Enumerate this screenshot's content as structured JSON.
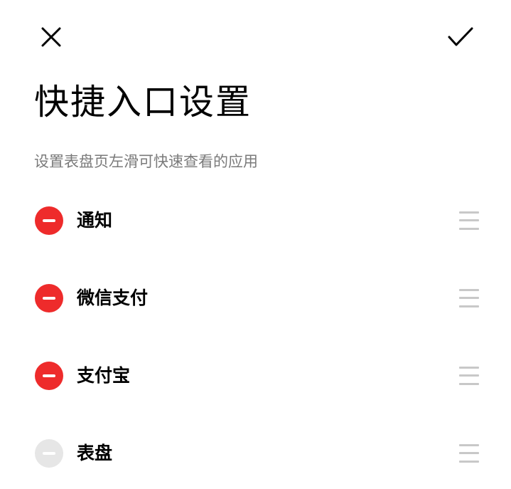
{
  "header": {
    "close_icon": "close-icon",
    "confirm_icon": "checkmark-icon"
  },
  "title": "快捷入口设置",
  "subtitle": "设置表盘页左滑可快速查看的应用",
  "items": [
    {
      "label": "通知",
      "enabled": true,
      "action_icon": "minus-circle-icon"
    },
    {
      "label": "微信支付",
      "enabled": true,
      "action_icon": "minus-circle-icon"
    },
    {
      "label": "支付宝",
      "enabled": true,
      "action_icon": "minus-circle-icon"
    },
    {
      "label": "表盘",
      "enabled": false,
      "action_icon": "minus-circle-icon"
    }
  ],
  "colors": {
    "remove_active": "#ee2b2b",
    "remove_disabled": "#e6e6e6",
    "subtitle": "#7a7a7a",
    "drag_handle": "#c8c8c8"
  }
}
